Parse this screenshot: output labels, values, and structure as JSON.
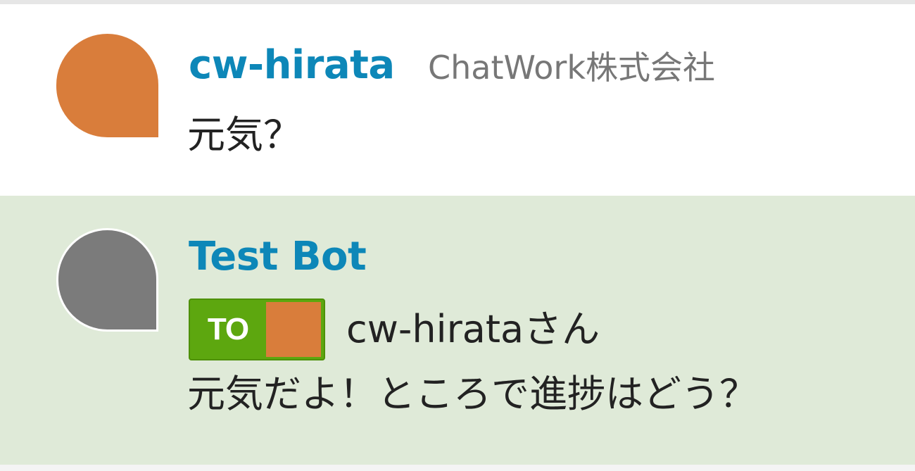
{
  "messages": [
    {
      "sender": "cw-hirata",
      "organization": "ChatWork株式会社",
      "text": "元気？",
      "avatar_color": "#d97d3b"
    },
    {
      "sender": "Test Bot",
      "to_label": "TO",
      "to_target": "cw-hirataさん",
      "text": "元気だよ！ところで進捗はどう？",
      "avatar_color": "#7b7b7b"
    }
  ],
  "colors": {
    "sender_name": "#0d87b8",
    "highlight_background": "#dfead8",
    "to_badge": "#5da70f"
  }
}
